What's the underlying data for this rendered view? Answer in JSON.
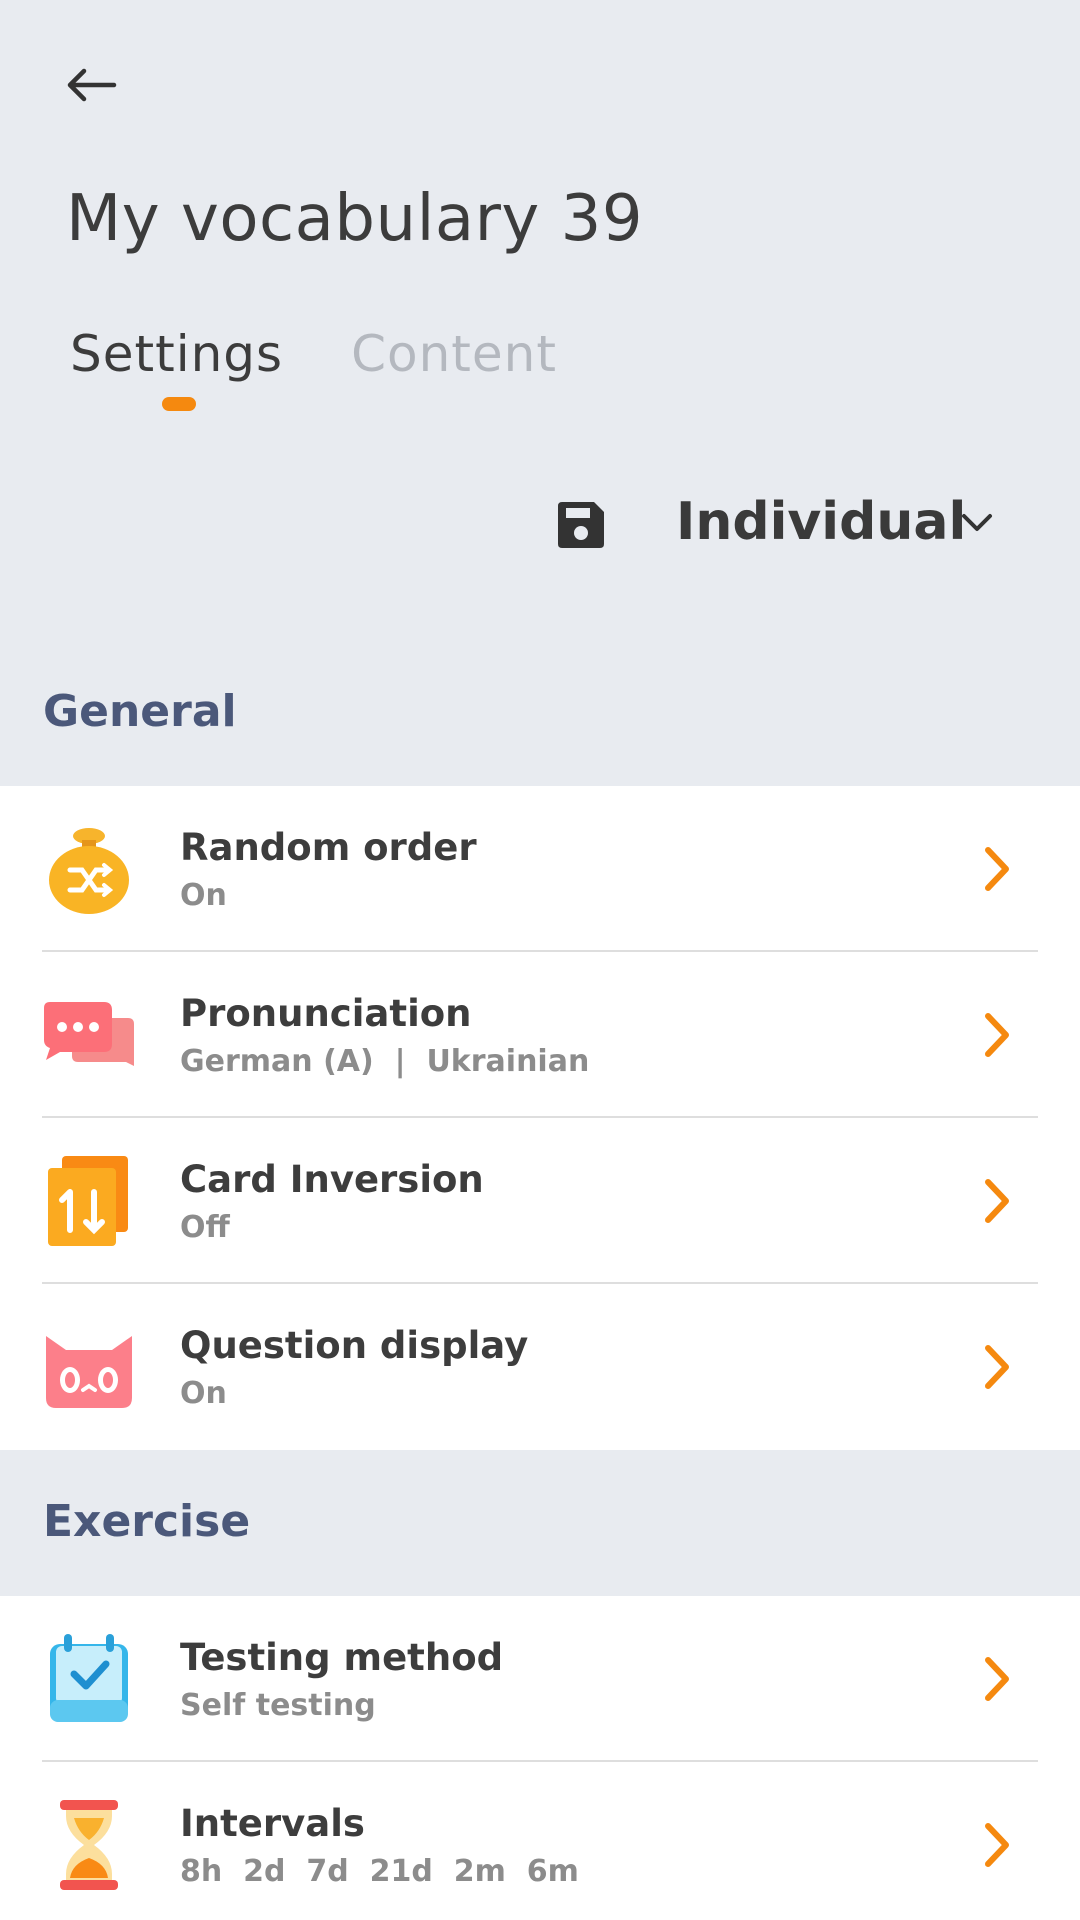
{
  "header": {
    "title": "My vocabulary 39",
    "tabs": [
      {
        "label": "Settings"
      },
      {
        "label": "Content"
      }
    ]
  },
  "toolbar": {
    "mode": "Individual"
  },
  "sections": {
    "general": {
      "title": "General",
      "items": [
        {
          "label": "Random order",
          "value": "On",
          "icon": "shuffle-bag-icon"
        },
        {
          "label": "Pronunciation",
          "value": "German (A)  |  Ukrainian",
          "icon": "speech-bubbles-icon"
        },
        {
          "label": "Card Inversion",
          "value": "Off",
          "icon": "card-inversion-icon"
        },
        {
          "label": "Question display",
          "value": "On",
          "icon": "cat-face-icon"
        }
      ]
    },
    "exercise": {
      "title": "Exercise",
      "items": [
        {
          "label": "Testing method",
          "value": "Self testing",
          "icon": "calendar-check-icon"
        },
        {
          "label": "Intervals",
          "value": "8h  2d  7d  21d  2m  6m",
          "icon": "hourglass-icon"
        }
      ]
    }
  },
  "colors": {
    "accent": "#f5890f",
    "background": "#e8ebf0",
    "section_title": "#4b587a"
  }
}
